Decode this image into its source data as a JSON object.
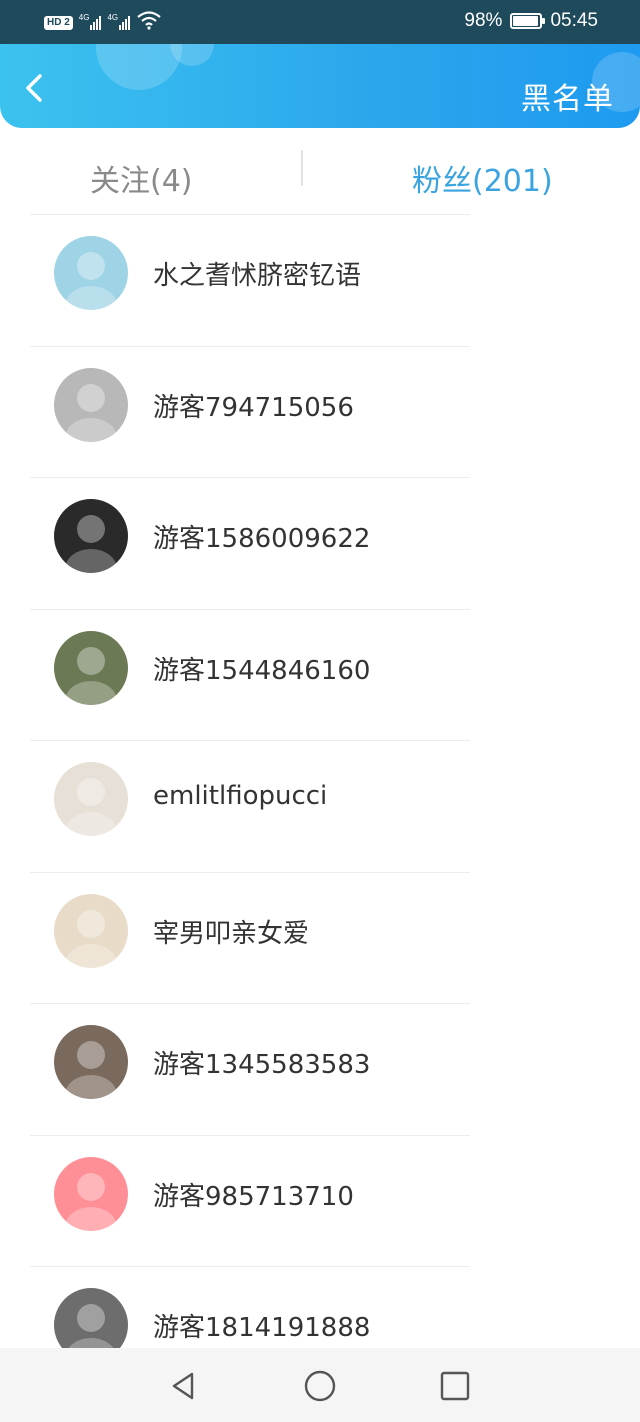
{
  "status_bar": {
    "hd_label": "HD 2",
    "network_1": "4G",
    "network_2": "4G",
    "battery_percent": "98%",
    "battery_level": 0.98,
    "time": "05:45"
  },
  "header": {
    "back_icon": "chevron-left-icon",
    "blacklist_label": "黑名单"
  },
  "tabs": [
    {
      "label": "关注(4)",
      "active": false
    },
    {
      "label": "粉丝(201)",
      "active": true
    }
  ],
  "users": [
    {
      "name": "水之耆怵脐密钇语",
      "avatar_color": "#9fd3e6"
    },
    {
      "name": "游客794715056",
      "avatar_color": "#b8b8b8"
    },
    {
      "name": "游客1586009622",
      "avatar_color": "#2a2a2a"
    },
    {
      "name": "游客1544846160",
      "avatar_color": "#6b7a55"
    },
    {
      "name": "emlitlfiopucci",
      "avatar_color": "#e6e0d6"
    },
    {
      "name": "宰男叩亲女爱",
      "avatar_color": "#e8dcc8"
    },
    {
      "name": "游客1345583583",
      "avatar_color": "#7a6a5e"
    },
    {
      "name": "游客985713710",
      "avatar_color": "#ff8f96"
    },
    {
      "name": "游客1814191888",
      "avatar_color": "#6d6d6d"
    }
  ],
  "nav": {
    "back": "triangle-back-icon",
    "home": "circle-home-icon",
    "recents": "square-recents-icon"
  }
}
